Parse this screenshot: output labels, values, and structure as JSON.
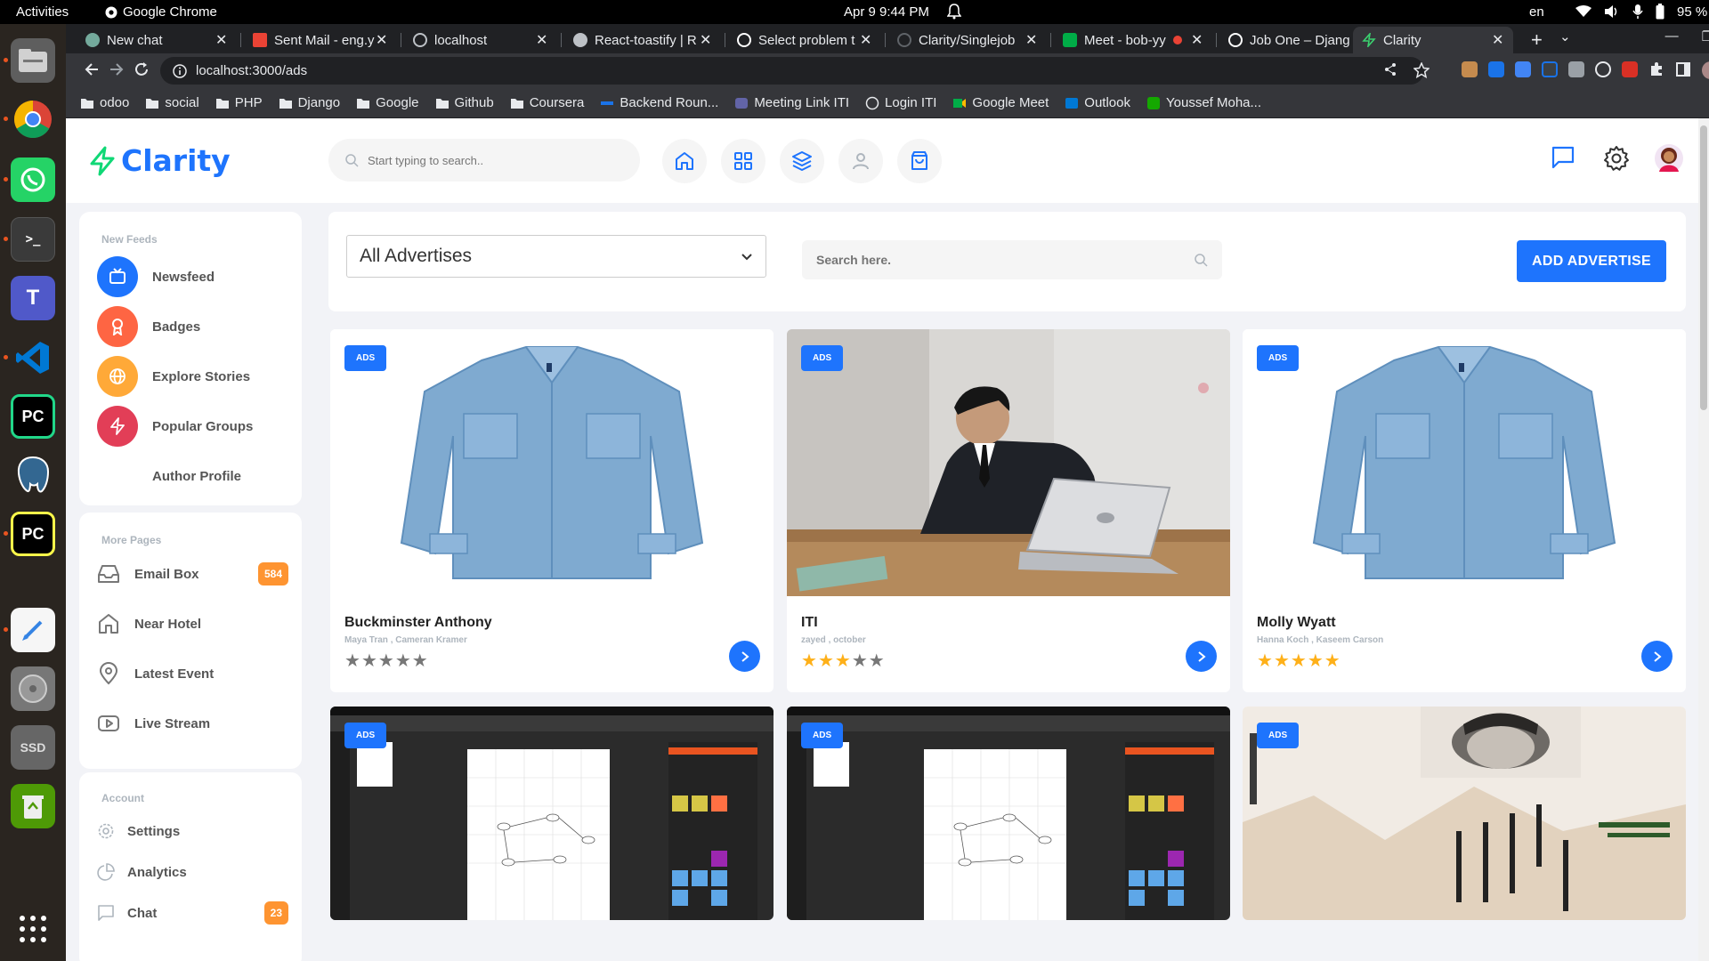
{
  "os": {
    "activities": "Activities",
    "app_name": "Google Chrome",
    "clock": "Apr 9  9:44 PM",
    "lang": "en",
    "battery": "95 %"
  },
  "browser": {
    "tabs": [
      {
        "title": "New chat",
        "icon_color": "#74aa9c"
      },
      {
        "title": "Sent Mail - eng.y",
        "icon_color": "#ea4335"
      },
      {
        "title": "localhost",
        "icon_color": "#bdc1c6"
      },
      {
        "title": "React-toastify | R",
        "icon_color": "#bdc1c6"
      },
      {
        "title": "Select problem t",
        "icon_color": "#ffffff"
      },
      {
        "title": "Clarity/Singlejob",
        "icon_color": "#202124"
      },
      {
        "title": "Meet - bob-yy",
        "icon_color": "#00ac47"
      },
      {
        "title": "Job One – Djang",
        "icon_color": "#ffffff"
      },
      {
        "title": "Clarity",
        "icon_color": "#3bd16f"
      }
    ],
    "url": "localhost:3000/ads",
    "bookmarks": [
      {
        "label": "odoo",
        "icon": "folder-icon"
      },
      {
        "label": "social",
        "icon": "folder-icon"
      },
      {
        "label": "PHP",
        "icon": "folder-icon"
      },
      {
        "label": "Django",
        "icon": "folder-icon"
      },
      {
        "label": "Google",
        "icon": "folder-icon"
      },
      {
        "label": "Github",
        "icon": "folder-icon"
      },
      {
        "label": "Coursera",
        "icon": "folder-icon"
      },
      {
        "label": "Backend Roun...",
        "icon": "roadmap-icon"
      },
      {
        "label": "Meeting Link ITI",
        "icon": "teams-icon"
      },
      {
        "label": "Login ITI",
        "icon": "globe-icon"
      },
      {
        "label": "Google Meet",
        "icon": "meet-icon"
      },
      {
        "label": "Outlook",
        "icon": "outlook-icon"
      },
      {
        "label": "Youssef Moha...",
        "icon": "upwork-icon"
      }
    ]
  },
  "app": {
    "logo": "Clarity",
    "search_placeholder": "Start typing to search..",
    "sidebar": {
      "new_feeds_heading": "New Feeds",
      "new_feeds": [
        {
          "label": "Newsfeed",
          "color": "#1e74fd"
        },
        {
          "label": "Badges",
          "color": "#fe6543"
        },
        {
          "label": "Explore Stories",
          "color": "#ffa938"
        },
        {
          "label": "Popular Groups",
          "color": "#e23e57"
        },
        {
          "label": "Author Profile",
          "color": "#333333"
        }
      ],
      "more_pages_heading": "More Pages",
      "more_pages": [
        {
          "label": "Email Box",
          "badge": "584"
        },
        {
          "label": "Near Hotel",
          "badge": ""
        },
        {
          "label": "Latest Event",
          "badge": ""
        },
        {
          "label": "Live Stream",
          "badge": ""
        }
      ],
      "account_heading": "Account",
      "account": [
        {
          "label": "Settings",
          "badge": ""
        },
        {
          "label": "Analytics",
          "badge": ""
        },
        {
          "label": "Chat",
          "badge": "23"
        }
      ]
    },
    "filter": {
      "selected": "All Advertises",
      "search_placeholder": "Search here.",
      "add_button": "ADD ADVERTISE"
    },
    "ads": [
      {
        "badge": "ADS",
        "title": "Buckminster Anthony",
        "subtitle": "Maya Tran , Cameran Kramer",
        "rating": 0,
        "image": "denim-shirt"
      },
      {
        "badge": "ADS",
        "title": "ITI",
        "subtitle": "zayed , october",
        "rating": 3,
        "image": "man-laptop"
      },
      {
        "badge": "ADS",
        "title": "Molly Wyatt",
        "subtitle": "Hanna Koch , Kaseem Carson",
        "rating": 5,
        "image": "denim-shirt"
      },
      {
        "badge": "ADS",
        "image": "screenshot-diagram"
      },
      {
        "badge": "ADS",
        "image": "screenshot-diagram"
      },
      {
        "badge": "ADS",
        "image": "id-card-scan"
      }
    ],
    "colors": {
      "primary": "#1e74fd",
      "badge_orange": "#fe9431",
      "star_gold": "#feb019",
      "star_gray": "#777777"
    }
  }
}
